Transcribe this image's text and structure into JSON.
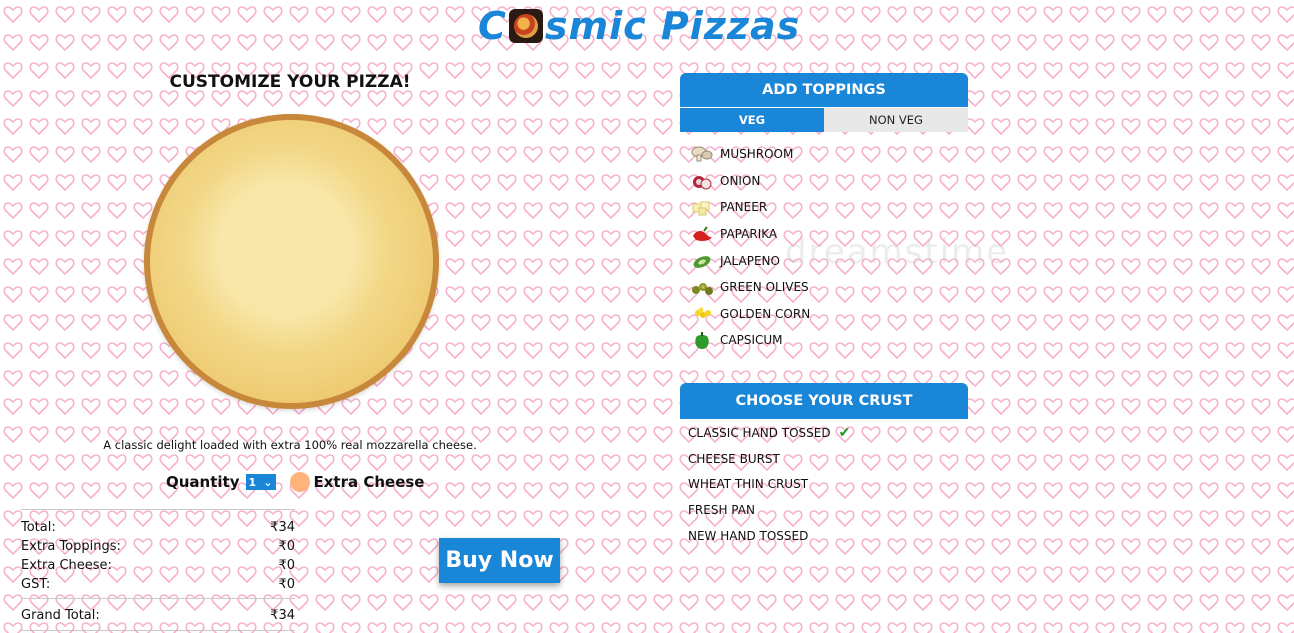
{
  "header": {
    "logo_prefix": "C",
    "logo_suffix": "smic Pizzas"
  },
  "pizza": {
    "title": "CUSTOMIZE YOUR PIZZA!",
    "description": "A classic delight loaded with extra 100% real mozzarella cheese."
  },
  "options": {
    "quantity_label": "Quantity",
    "quantity_value": "1",
    "extra_cheese_label": "Extra Cheese"
  },
  "totals": {
    "rows": [
      {
        "label": "Total:",
        "value": "₹34"
      },
      {
        "label": "Extra Toppings:",
        "value": "₹0"
      },
      {
        "label": "Extra Cheese:",
        "value": "₹0"
      },
      {
        "label": "GST:",
        "value": "₹0"
      }
    ],
    "grand": {
      "label": "Grand Total:",
      "value": "₹34"
    }
  },
  "buy_button": "Buy Now",
  "toppings": {
    "header": "ADD TOPPINGS",
    "tabs": [
      {
        "label": "VEG",
        "active": true
      },
      {
        "label": "NON VEG",
        "active": false
      }
    ],
    "items": [
      {
        "label": "MUSHROOM",
        "icon": "mushroom-icon"
      },
      {
        "label": "ONION",
        "icon": "onion-icon"
      },
      {
        "label": "PANEER",
        "icon": "paneer-icon"
      },
      {
        "label": "PAPARIKA",
        "icon": "paprika-icon"
      },
      {
        "label": "JALAPENO",
        "icon": "jalapeno-icon"
      },
      {
        "label": "GREEN OLIVES",
        "icon": "olives-icon"
      },
      {
        "label": "GOLDEN CORN",
        "icon": "corn-icon"
      },
      {
        "label": "CAPSICUM",
        "icon": "capsicum-icon"
      }
    ]
  },
  "crust": {
    "header": "CHOOSE YOUR CRUST",
    "items": [
      {
        "label": "CLASSIC HAND TOSSED",
        "selected": true
      },
      {
        "label": "CHEESE BURST",
        "selected": false
      },
      {
        "label": "WHEAT THIN CRUST",
        "selected": false
      },
      {
        "label": "FRESH PAN",
        "selected": false
      },
      {
        "label": "NEW HAND TOSSED",
        "selected": false
      }
    ]
  },
  "colors": {
    "accent": "#1a86d8",
    "heart_pattern": "#f7b0cf",
    "extra_cheese_toggle": "#ffb27a",
    "check": "#1e9b22"
  }
}
